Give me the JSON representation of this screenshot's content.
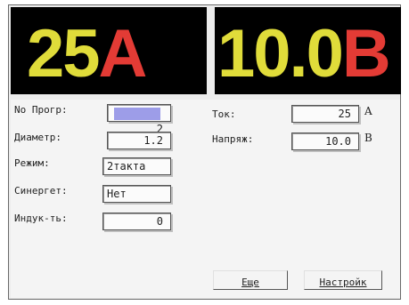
{
  "display": {
    "current_value": "25",
    "current_unit": "A",
    "voltage_value": "10.0",
    "voltage_unit": "B"
  },
  "form": {
    "program_label": "No Прогр:",
    "program_value": "2",
    "diameter_label": "Диаметр:",
    "diameter_value": "1.2",
    "mode_label": "Режим:",
    "mode_value": "2такта",
    "synergy_label": "Синергет:",
    "synergy_value": "Нет",
    "inductance_label": "Индук-ть:",
    "inductance_value": "0",
    "current_label": "Ток:",
    "current_value": "25",
    "current_unit": "A",
    "voltage_label": "Напряж:",
    "voltage_value": "10.0",
    "voltage_unit": "B"
  },
  "buttons": {
    "more_label": "Еще",
    "settings_label": "Настройк"
  },
  "colors": {
    "digits": "#e0dc3a",
    "units": "#e33b35",
    "highlight": "#9d9de8"
  }
}
